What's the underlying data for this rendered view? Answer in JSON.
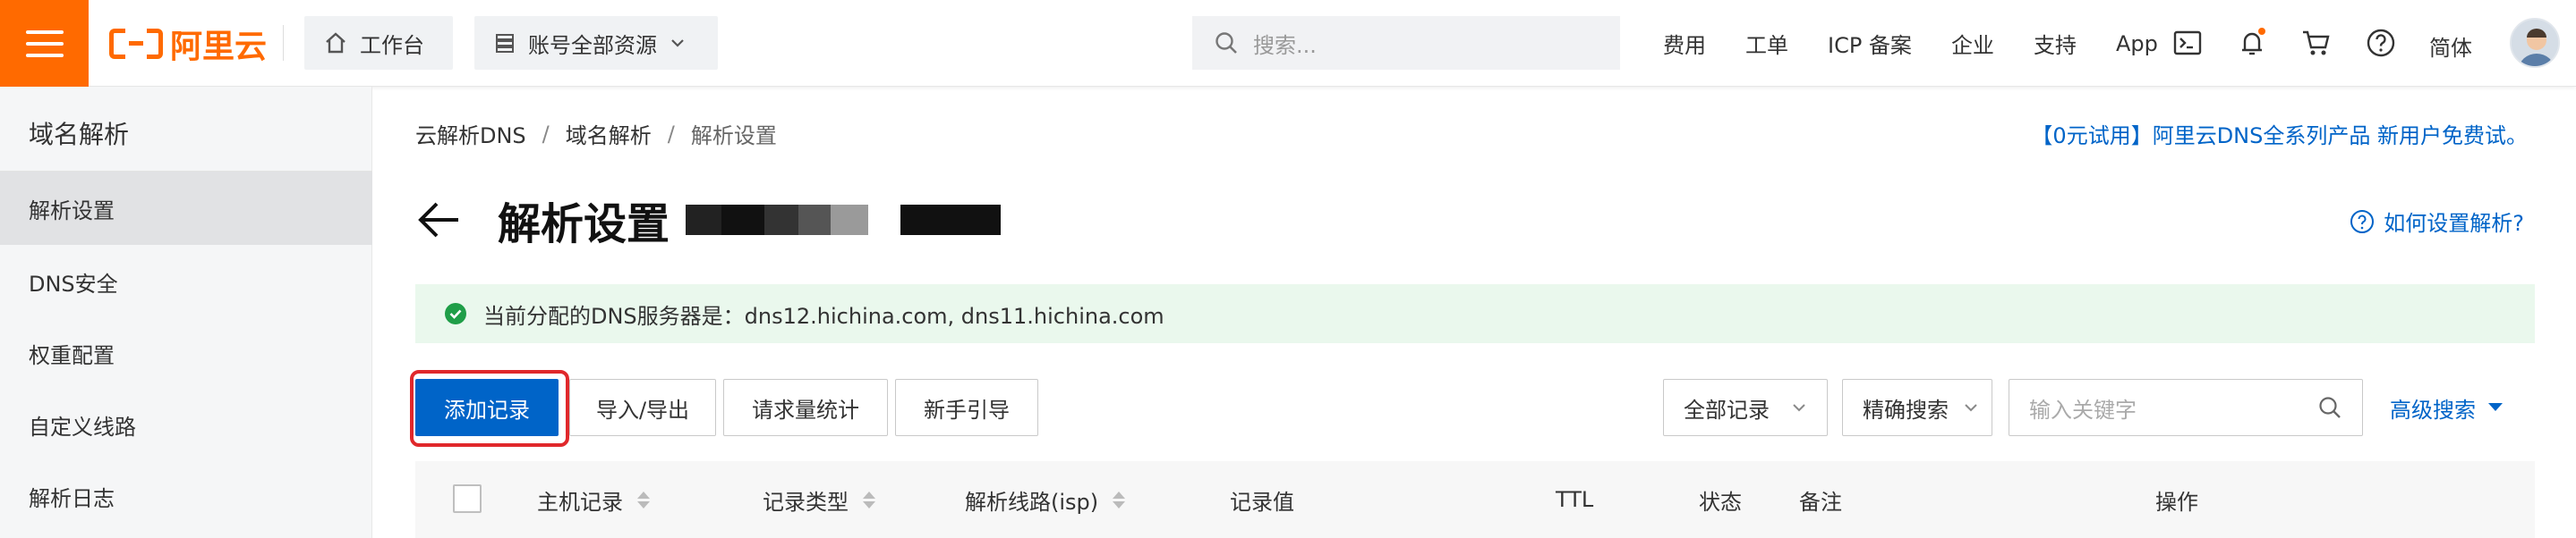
{
  "header": {
    "logo_text": "阿里云",
    "workbench": "工作台",
    "account_resources": "账号全部资源",
    "search_placeholder": "搜索...",
    "links": [
      "费用",
      "工单",
      "ICP 备案",
      "企业",
      "支持",
      "App"
    ],
    "lang": "简体"
  },
  "sidebar": {
    "title": "域名解析",
    "items": [
      {
        "label": "解析设置",
        "active": true
      },
      {
        "label": "DNS安全",
        "active": false
      },
      {
        "label": "权重配置",
        "active": false
      },
      {
        "label": "自定义线路",
        "active": false
      },
      {
        "label": "解析日志",
        "active": false
      }
    ]
  },
  "breadcrumb": [
    "云解析DNS",
    "域名解析",
    "解析设置"
  ],
  "promo": "【0元试用】阿里云DNS全系列产品 新用户免费试。",
  "page_title": "解析设置",
  "help": "如何设置解析?",
  "notice": "当前分配的DNS服务器是：dns12.hichina.com, dns11.hichina.com",
  "toolbar": {
    "add_record": "添加记录",
    "import_export": "导入/导出",
    "request_stats": "请求量统计",
    "guide": "新手引导",
    "record_filter": "全部记录",
    "search_mode": "精确搜索",
    "keyword_placeholder": "输入关键字",
    "advanced_search": "高级搜索"
  },
  "table": {
    "columns": [
      "主机记录",
      "记录类型",
      "解析线路(isp)",
      "记录值",
      "TTL",
      "状态",
      "备注",
      "操作"
    ]
  },
  "colors": {
    "brand": "#ff6a00",
    "primary": "#0064c8",
    "highlight": "#e0282b",
    "success": "#1f9e48"
  }
}
